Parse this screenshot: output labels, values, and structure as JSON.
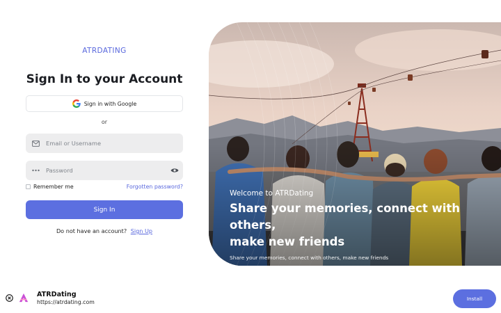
{
  "brand": {
    "name": "ATRDATING"
  },
  "login": {
    "title": "Sign In to your Account",
    "google_label": "Sign in with Google",
    "divider_text": "or",
    "email_placeholder": "Email or Username",
    "password_placeholder": "Password",
    "remember_label": "Remember me",
    "forgot_label": "Forgotten password?",
    "signin_label": "Sign In",
    "no_account_text": "Do not have an account?",
    "signup_label": "Sign Up"
  },
  "hero": {
    "welcome": "Welcome to ATRDating",
    "headline_line1": "Share your memories, connect with others,",
    "headline_line2": "make new friends",
    "subtitle": "Share your memories, connect with others, make new friends"
  },
  "install_bar": {
    "app_name": "ATRDating",
    "app_url": "https://atrdating.com",
    "install_label": "Install"
  },
  "colors": {
    "accent": "#5c6fe0",
    "field_bg": "#ededee",
    "brand_text": "#5867dd"
  },
  "icons": [
    "google-icon",
    "mail-icon",
    "password-dots-icon",
    "eye-icon",
    "close-circle-icon",
    "app-logo-icon"
  ]
}
